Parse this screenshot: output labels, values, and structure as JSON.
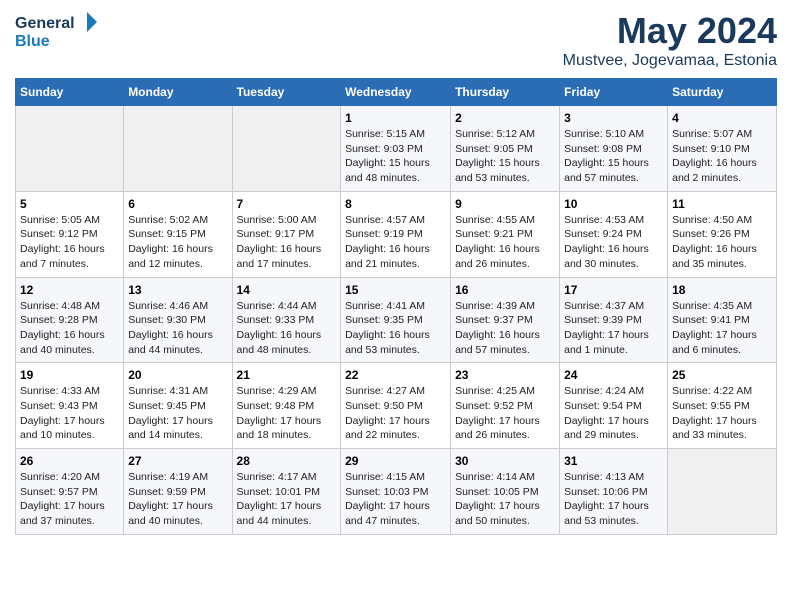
{
  "logo": {
    "line1": "General",
    "line2": "Blue"
  },
  "title": "May 2024",
  "location": "Mustvee, Jogevamaa, Estonia",
  "weekdays": [
    "Sunday",
    "Monday",
    "Tuesday",
    "Wednesday",
    "Thursday",
    "Friday",
    "Saturday"
  ],
  "weeks": [
    [
      {
        "day": "",
        "info": ""
      },
      {
        "day": "",
        "info": ""
      },
      {
        "day": "",
        "info": ""
      },
      {
        "day": "1",
        "info": "Sunrise: 5:15 AM\nSunset: 9:03 PM\nDaylight: 15 hours\nand 48 minutes."
      },
      {
        "day": "2",
        "info": "Sunrise: 5:12 AM\nSunset: 9:05 PM\nDaylight: 15 hours\nand 53 minutes."
      },
      {
        "day": "3",
        "info": "Sunrise: 5:10 AM\nSunset: 9:08 PM\nDaylight: 15 hours\nand 57 minutes."
      },
      {
        "day": "4",
        "info": "Sunrise: 5:07 AM\nSunset: 9:10 PM\nDaylight: 16 hours\nand 2 minutes."
      }
    ],
    [
      {
        "day": "5",
        "info": "Sunrise: 5:05 AM\nSunset: 9:12 PM\nDaylight: 16 hours\nand 7 minutes."
      },
      {
        "day": "6",
        "info": "Sunrise: 5:02 AM\nSunset: 9:15 PM\nDaylight: 16 hours\nand 12 minutes."
      },
      {
        "day": "7",
        "info": "Sunrise: 5:00 AM\nSunset: 9:17 PM\nDaylight: 16 hours\nand 17 minutes."
      },
      {
        "day": "8",
        "info": "Sunrise: 4:57 AM\nSunset: 9:19 PM\nDaylight: 16 hours\nand 21 minutes."
      },
      {
        "day": "9",
        "info": "Sunrise: 4:55 AM\nSunset: 9:21 PM\nDaylight: 16 hours\nand 26 minutes."
      },
      {
        "day": "10",
        "info": "Sunrise: 4:53 AM\nSunset: 9:24 PM\nDaylight: 16 hours\nand 30 minutes."
      },
      {
        "day": "11",
        "info": "Sunrise: 4:50 AM\nSunset: 9:26 PM\nDaylight: 16 hours\nand 35 minutes."
      }
    ],
    [
      {
        "day": "12",
        "info": "Sunrise: 4:48 AM\nSunset: 9:28 PM\nDaylight: 16 hours\nand 40 minutes."
      },
      {
        "day": "13",
        "info": "Sunrise: 4:46 AM\nSunset: 9:30 PM\nDaylight: 16 hours\nand 44 minutes."
      },
      {
        "day": "14",
        "info": "Sunrise: 4:44 AM\nSunset: 9:33 PM\nDaylight: 16 hours\nand 48 minutes."
      },
      {
        "day": "15",
        "info": "Sunrise: 4:41 AM\nSunset: 9:35 PM\nDaylight: 16 hours\nand 53 minutes."
      },
      {
        "day": "16",
        "info": "Sunrise: 4:39 AM\nSunset: 9:37 PM\nDaylight: 16 hours\nand 57 minutes."
      },
      {
        "day": "17",
        "info": "Sunrise: 4:37 AM\nSunset: 9:39 PM\nDaylight: 17 hours\nand 1 minute."
      },
      {
        "day": "18",
        "info": "Sunrise: 4:35 AM\nSunset: 9:41 PM\nDaylight: 17 hours\nand 6 minutes."
      }
    ],
    [
      {
        "day": "19",
        "info": "Sunrise: 4:33 AM\nSunset: 9:43 PM\nDaylight: 17 hours\nand 10 minutes."
      },
      {
        "day": "20",
        "info": "Sunrise: 4:31 AM\nSunset: 9:45 PM\nDaylight: 17 hours\nand 14 minutes."
      },
      {
        "day": "21",
        "info": "Sunrise: 4:29 AM\nSunset: 9:48 PM\nDaylight: 17 hours\nand 18 minutes."
      },
      {
        "day": "22",
        "info": "Sunrise: 4:27 AM\nSunset: 9:50 PM\nDaylight: 17 hours\nand 22 minutes."
      },
      {
        "day": "23",
        "info": "Sunrise: 4:25 AM\nSunset: 9:52 PM\nDaylight: 17 hours\nand 26 minutes."
      },
      {
        "day": "24",
        "info": "Sunrise: 4:24 AM\nSunset: 9:54 PM\nDaylight: 17 hours\nand 29 minutes."
      },
      {
        "day": "25",
        "info": "Sunrise: 4:22 AM\nSunset: 9:55 PM\nDaylight: 17 hours\nand 33 minutes."
      }
    ],
    [
      {
        "day": "26",
        "info": "Sunrise: 4:20 AM\nSunset: 9:57 PM\nDaylight: 17 hours\nand 37 minutes."
      },
      {
        "day": "27",
        "info": "Sunrise: 4:19 AM\nSunset: 9:59 PM\nDaylight: 17 hours\nand 40 minutes."
      },
      {
        "day": "28",
        "info": "Sunrise: 4:17 AM\nSunset: 10:01 PM\nDaylight: 17 hours\nand 44 minutes."
      },
      {
        "day": "29",
        "info": "Sunrise: 4:15 AM\nSunset: 10:03 PM\nDaylight: 17 hours\nand 47 minutes."
      },
      {
        "day": "30",
        "info": "Sunrise: 4:14 AM\nSunset: 10:05 PM\nDaylight: 17 hours\nand 50 minutes."
      },
      {
        "day": "31",
        "info": "Sunrise: 4:13 AM\nSunset: 10:06 PM\nDaylight: 17 hours\nand 53 minutes."
      },
      {
        "day": "",
        "info": ""
      }
    ]
  ]
}
